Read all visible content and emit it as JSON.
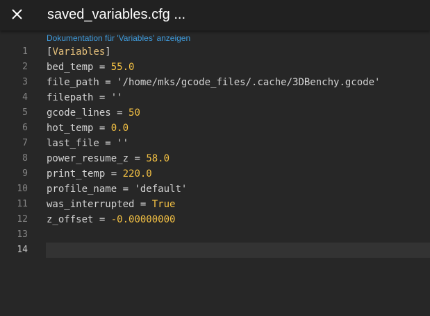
{
  "titlebar": {
    "title": "saved_variables.cfg ...",
    "close_icon": "close-icon"
  },
  "editor": {
    "codelens_text": "Dokumentation für 'Variables' anzeigen",
    "current_line": 14,
    "lines": [
      {
        "number": "1",
        "tokens": [
          {
            "t": "[",
            "c": "bracket"
          },
          {
            "t": "Variables",
            "c": "section"
          },
          {
            "t": "]",
            "c": "bracket"
          }
        ]
      },
      {
        "number": "2",
        "tokens": [
          {
            "t": "bed_temp",
            "c": "key"
          },
          {
            "t": " = ",
            "c": "op"
          },
          {
            "t": "55.0",
            "c": "num"
          }
        ]
      },
      {
        "number": "3",
        "tokens": [
          {
            "t": "file_path",
            "c": "key"
          },
          {
            "t": " = ",
            "c": "op"
          },
          {
            "t": "'/home/mks/gcode_files/.cache/3DBenchy.gcode'",
            "c": "str"
          }
        ]
      },
      {
        "number": "4",
        "tokens": [
          {
            "t": "filepath",
            "c": "key"
          },
          {
            "t": " = ",
            "c": "op"
          },
          {
            "t": "''",
            "c": "str"
          }
        ]
      },
      {
        "number": "5",
        "tokens": [
          {
            "t": "gcode_lines",
            "c": "key"
          },
          {
            "t": " = ",
            "c": "op"
          },
          {
            "t": "50",
            "c": "num"
          }
        ]
      },
      {
        "number": "6",
        "tokens": [
          {
            "t": "hot_temp",
            "c": "key"
          },
          {
            "t": " = ",
            "c": "op"
          },
          {
            "t": "0.0",
            "c": "num"
          }
        ]
      },
      {
        "number": "7",
        "tokens": [
          {
            "t": "last_file",
            "c": "key"
          },
          {
            "t": " = ",
            "c": "op"
          },
          {
            "t": "''",
            "c": "str"
          }
        ]
      },
      {
        "number": "8",
        "tokens": [
          {
            "t": "power_resume_z",
            "c": "key"
          },
          {
            "t": " = ",
            "c": "op"
          },
          {
            "t": "58.0",
            "c": "num"
          }
        ]
      },
      {
        "number": "9",
        "tokens": [
          {
            "t": "print_temp",
            "c": "key"
          },
          {
            "t": " = ",
            "c": "op"
          },
          {
            "t": "220.0",
            "c": "num"
          }
        ]
      },
      {
        "number": "10",
        "tokens": [
          {
            "t": "profile_name",
            "c": "key"
          },
          {
            "t": " = ",
            "c": "op"
          },
          {
            "t": "'default'",
            "c": "str"
          }
        ]
      },
      {
        "number": "11",
        "tokens": [
          {
            "t": "was_interrupted",
            "c": "key"
          },
          {
            "t": " = ",
            "c": "op"
          },
          {
            "t": "True",
            "c": "bool"
          }
        ]
      },
      {
        "number": "12",
        "tokens": [
          {
            "t": "z_offset",
            "c": "key"
          },
          {
            "t": " = ",
            "c": "op"
          },
          {
            "t": "-0.00000000",
            "c": "num"
          }
        ]
      },
      {
        "number": "13",
        "tokens": []
      },
      {
        "number": "14",
        "tokens": []
      }
    ]
  },
  "colors": {
    "titlebar_bg": "#212121",
    "editor_bg": "#272727",
    "codelens": "#3f9bdc",
    "number": "#f5c244",
    "section": "#e5c07b"
  }
}
